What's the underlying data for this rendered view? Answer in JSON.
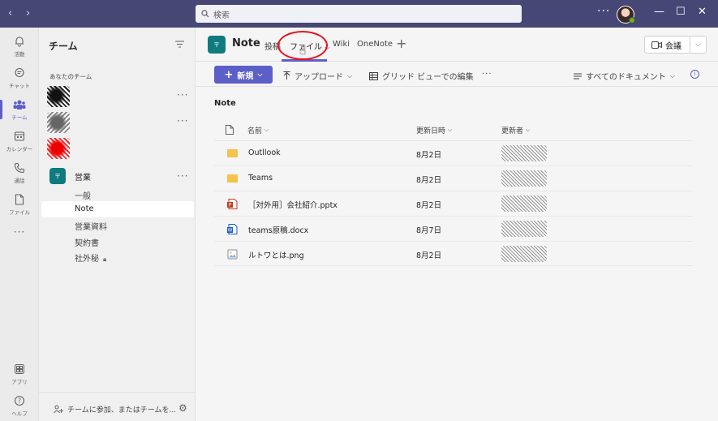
{
  "titlebar": {
    "search_placeholder": "検索",
    "more": "···",
    "minimize": "—",
    "maximize": "☐",
    "close": "✕"
  },
  "rail": [
    {
      "label": "活動",
      "icon": "bell-icon"
    },
    {
      "label": "チャット",
      "icon": "chat-icon"
    },
    {
      "label": "チーム",
      "icon": "teams-icon",
      "active": true
    },
    {
      "label": "カレンダー",
      "icon": "calendar-icon"
    },
    {
      "label": "通話",
      "icon": "phone-icon"
    },
    {
      "label": "ファイル",
      "icon": "file-icon"
    },
    {
      "label": "···",
      "icon": "more-icon"
    },
    {
      "label": "アプリ",
      "icon": "apps-icon"
    },
    {
      "label": "ヘルプ",
      "icon": "help-icon"
    }
  ],
  "teams_panel": {
    "title": "チーム",
    "section": "あなたのチーム",
    "team": {
      "icon_text": "〒",
      "name": "営業"
    },
    "channels": [
      "一般",
      "Note",
      "営業資料",
      "契約書",
      "社外秘"
    ],
    "join_text": "チームに参加、またはチームを..."
  },
  "header": {
    "channel_icon": "〒",
    "channel": "Note",
    "tabs": [
      "投稿",
      "ファイル",
      "Wiki",
      "OneNote"
    ],
    "add": "+",
    "meet": "会議",
    "meet_chevron": "⌵"
  },
  "toolbar": {
    "new": "新規",
    "upload": "アップロード",
    "grid": "グリッド ビューでの編集",
    "more": "···",
    "all_docs": "すべてのドキュメント",
    "info": "i"
  },
  "breadcrumb": "Note",
  "columns": {
    "name": "名前",
    "modified": "更新日時",
    "modified_by": "更新者"
  },
  "files": [
    {
      "name": "Outllook",
      "date": "8月2日",
      "type": "folder"
    },
    {
      "name": "Teams",
      "date": "8月2日",
      "type": "folder"
    },
    {
      "name": "［対外用］会社紹介.pptx",
      "date": "8月2日",
      "type": "pptx"
    },
    {
      "name": "teams原稿.docx",
      "date": "8月7日",
      "type": "docx"
    },
    {
      "name": "ルトワとは.png",
      "date": "8月2日",
      "type": "png"
    }
  ],
  "colors": {
    "brand": "#464775",
    "accent": "#5b5fc7",
    "team": "#0f7b7f",
    "highlight": "#e8101c"
  }
}
